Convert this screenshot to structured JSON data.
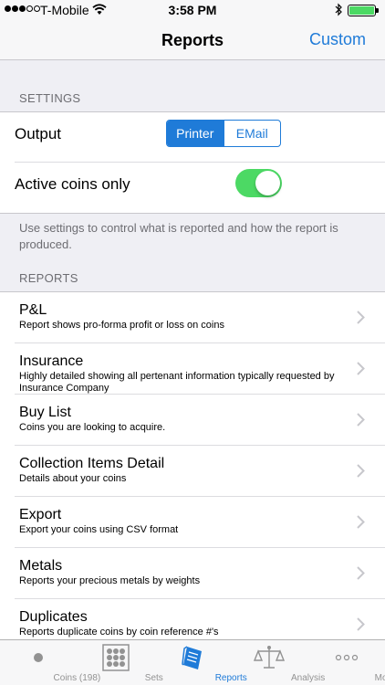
{
  "status": {
    "carrier": "T-Mobile",
    "time": "3:58 PM"
  },
  "nav": {
    "title": "Reports",
    "right_button": "Custom"
  },
  "settings": {
    "header": "SETTINGS",
    "output_label": "Output",
    "output_options": [
      "Printer",
      "EMail"
    ],
    "output_selected": "Printer",
    "active_coins_label": "Active coins only",
    "active_coins_on": true,
    "footer": "Use settings to control what is reported and how the report is produced."
  },
  "reports": {
    "header": "REPORTS",
    "items": [
      {
        "title": "P&L",
        "subtitle": "Report shows pro-forma profit or loss on coins"
      },
      {
        "title": "Insurance",
        "subtitle": "Highly detailed showing all pertenant information typically requested by Insurance Company"
      },
      {
        "title": "Buy List",
        "subtitle": "Coins you are looking to acquire."
      },
      {
        "title": "Collection Items Detail",
        "subtitle": "Details about your coins"
      },
      {
        "title": "Export",
        "subtitle": "Export your coins using CSV format"
      },
      {
        "title": "Metals",
        "subtitle": "Reports your precious metals by weights"
      },
      {
        "title": "Duplicates",
        "subtitle": "Reports duplicate coins by coin reference #'s"
      }
    ]
  },
  "tabs": [
    {
      "label": "Coins (198)",
      "icon": "coin-icon"
    },
    {
      "label": "Sets",
      "icon": "grid-icon"
    },
    {
      "label": "Reports",
      "icon": "book-icon",
      "active": true
    },
    {
      "label": "Analysis",
      "icon": "scales-icon"
    },
    {
      "label": "More",
      "icon": "more-icon"
    }
  ],
  "colors": {
    "accent": "#1f7bd8",
    "toggle_on": "#4cd964",
    "background": "#efeff4"
  }
}
